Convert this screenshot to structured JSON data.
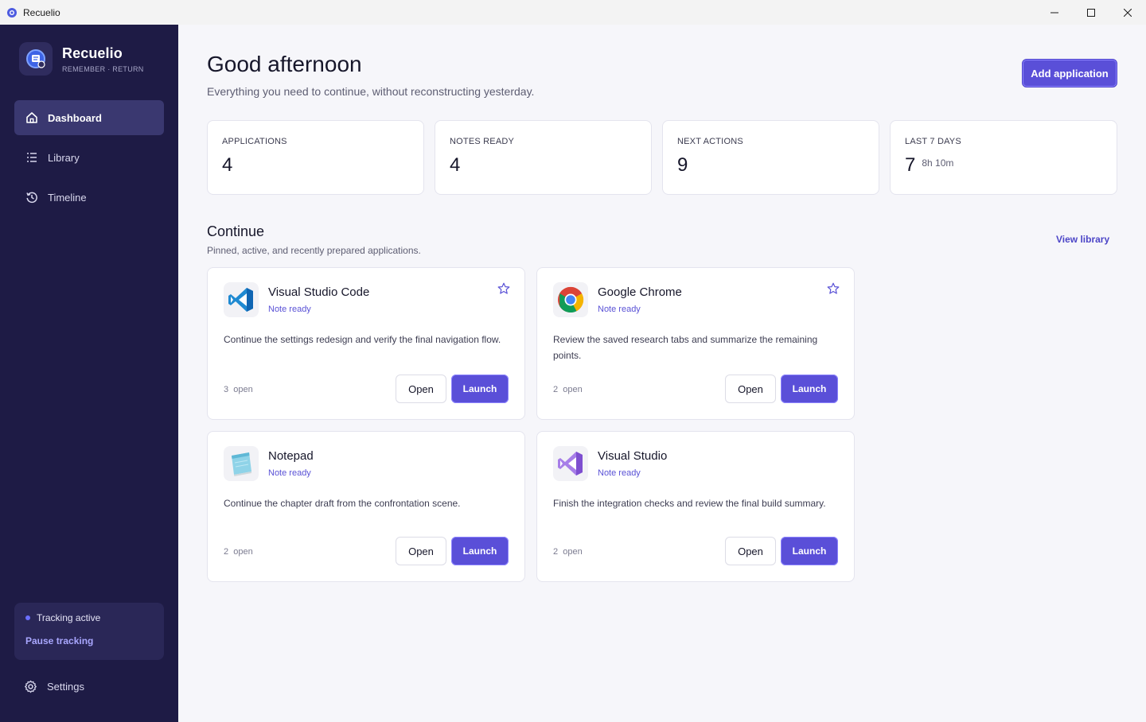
{
  "window": {
    "title": "Recuelio"
  },
  "sidebar": {
    "brand_name": "Recuelio",
    "brand_tagline": "REMEMBER · RETURN",
    "items": [
      {
        "label": "Dashboard",
        "icon": "home-icon",
        "active": true
      },
      {
        "label": "Library",
        "icon": "list-icon",
        "active": false
      },
      {
        "label": "Timeline",
        "icon": "history-icon",
        "active": false
      }
    ],
    "tracking_status": "Tracking active",
    "pause_label": "Pause tracking",
    "settings_label": "Settings"
  },
  "header": {
    "greeting": "Good afternoon",
    "subtitle": "Everything you need to continue, without reconstructing yesterday.",
    "add_button": "Add application"
  },
  "stats": [
    {
      "label": "APPLICATIONS",
      "value": "4",
      "extra": ""
    },
    {
      "label": "NOTES READY",
      "value": "4",
      "extra": ""
    },
    {
      "label": "NEXT ACTIONS",
      "value": "9",
      "extra": ""
    },
    {
      "label": "LAST 7 DAYS",
      "value": "7",
      "extra": "8h 10m"
    }
  ],
  "continue": {
    "title": "Continue",
    "subtitle": "Pinned, active, and recently prepared applications.",
    "view_library": "View library",
    "cards": [
      {
        "name": "Visual Studio Code",
        "status": "Note ready",
        "description": "Continue the settings redesign and verify the final navigation flow.",
        "open_count": "3",
        "open_label": "open",
        "open_button": "Open",
        "launch_button": "Launch",
        "icon": "vscode-icon",
        "pinned": true
      },
      {
        "name": "Google Chrome",
        "status": "Note ready",
        "description": "Review the saved research tabs and summarize the remaining points.",
        "open_count": "2",
        "open_label": "open",
        "open_button": "Open",
        "launch_button": "Launch",
        "icon": "chrome-icon",
        "pinned": true
      },
      {
        "name": "Notepad",
        "status": "Note ready",
        "description": "Continue the chapter draft from the confrontation scene.",
        "open_count": "2",
        "open_label": "open",
        "open_button": "Open",
        "launch_button": "Launch",
        "icon": "notepad-icon",
        "pinned": false
      },
      {
        "name": "Visual Studio",
        "status": "Note ready",
        "description": "Finish the integration checks and review the final build summary.",
        "open_count": "2",
        "open_label": "open",
        "open_button": "Open",
        "launch_button": "Launch",
        "icon": "visual-studio-icon",
        "pinned": false
      }
    ]
  },
  "colors": {
    "sidebar_bg": "#1e1b45",
    "accent": "#5a4fd8",
    "page_bg": "#f6f6fa"
  }
}
